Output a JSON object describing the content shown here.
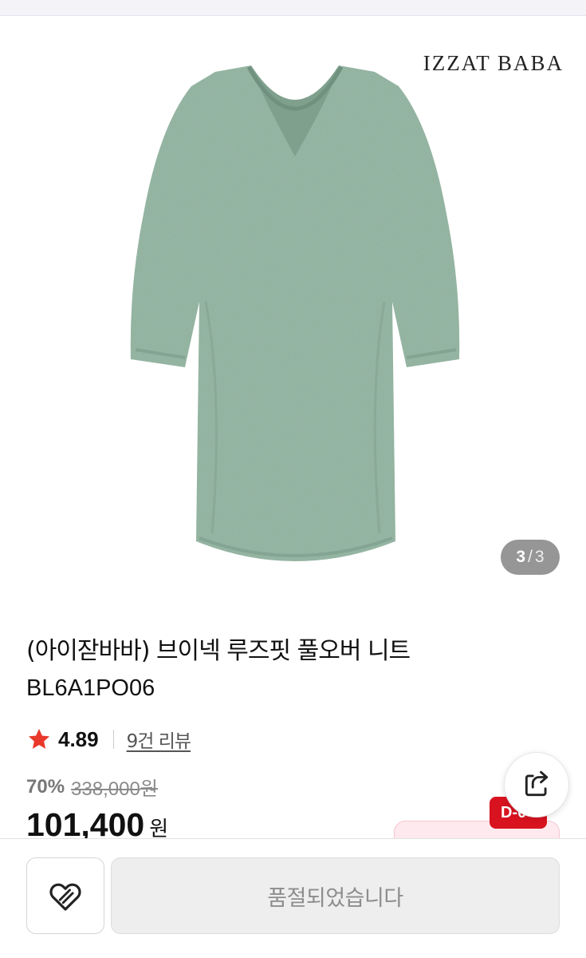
{
  "brand": {
    "logo_text": "IZZAT BABA"
  },
  "gallery": {
    "current": "3",
    "separator": "/",
    "total": "3",
    "image_subject": "green-v-neck-knit-pullover"
  },
  "product": {
    "title": "(아이잗바바) 브이넥 루즈핏 풀오버 니트",
    "code": "BL6A1PO06",
    "rating": "4.89",
    "review_link": "9건 리뷰",
    "discount_rate": "70%",
    "original_price_number": "338,000",
    "original_price_unit": "원",
    "final_price_number": "101,400",
    "final_price_unit": "원"
  },
  "badges": {
    "dday": "D-0"
  },
  "actions": {
    "soldout_label": "품절되었습니다",
    "wishlist_icon": "heart-icon",
    "share_icon": "share-icon"
  },
  "colors": {
    "star": "#e8392c",
    "dday_badge": "#d8121f",
    "garment": "#8dae9b",
    "soldout_bg": "#eeeeee"
  }
}
